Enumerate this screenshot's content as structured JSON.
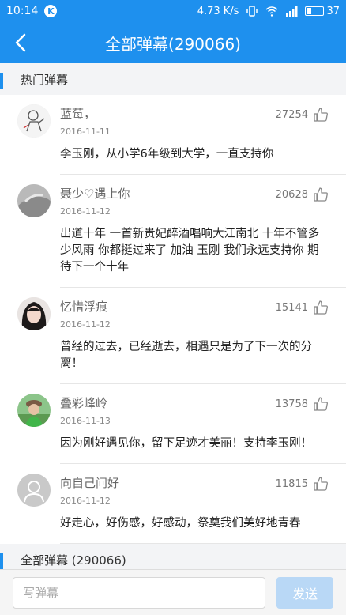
{
  "status_bar": {
    "time": "10:14",
    "app_badge": "K",
    "network_speed": "4.73 K/s",
    "battery": "37"
  },
  "header": {
    "title": "全部弹幕(290066)"
  },
  "sections": {
    "hot_label": "热门弹幕",
    "all_label": "全部弹幕 (290066)"
  },
  "comments": [
    {
      "user": "蓝莓，",
      "date": "2016-11-11",
      "likes": "27254",
      "text": "李玉刚，从小学6年级到大学，一直支持你"
    },
    {
      "user": "聂少♡遇上你",
      "date": "2016-11-12",
      "likes": "20628",
      "text": "出道十年  一首新贵妃醉酒唱响大江南北  十年不管多少风雨  你都挺过来了  加油  玉刚  我们永远支持你  期待下一个十年"
    },
    {
      "user": "忆惜浮痕",
      "date": "2016-11-12",
      "likes": "15141",
      "text": "曾经的过去，已经逝去，相遇只是为了下一次的分离！"
    },
    {
      "user": "叠彩峰岭",
      "date": "2016-11-13",
      "likes": "13758",
      "text": "因为刚好遇见你，留下足迹才美丽！支持李玉刚！"
    },
    {
      "user": "向自己问好",
      "date": "2016-11-12",
      "likes": "11815",
      "text": "好走心，好伤感，好感动，祭奠我们美好地青春"
    }
  ],
  "input_bar": {
    "placeholder": "写弹幕",
    "send_label": "发送"
  },
  "colors": {
    "accent": "#1e90ee",
    "send_disabled": "#b9d8f6"
  }
}
